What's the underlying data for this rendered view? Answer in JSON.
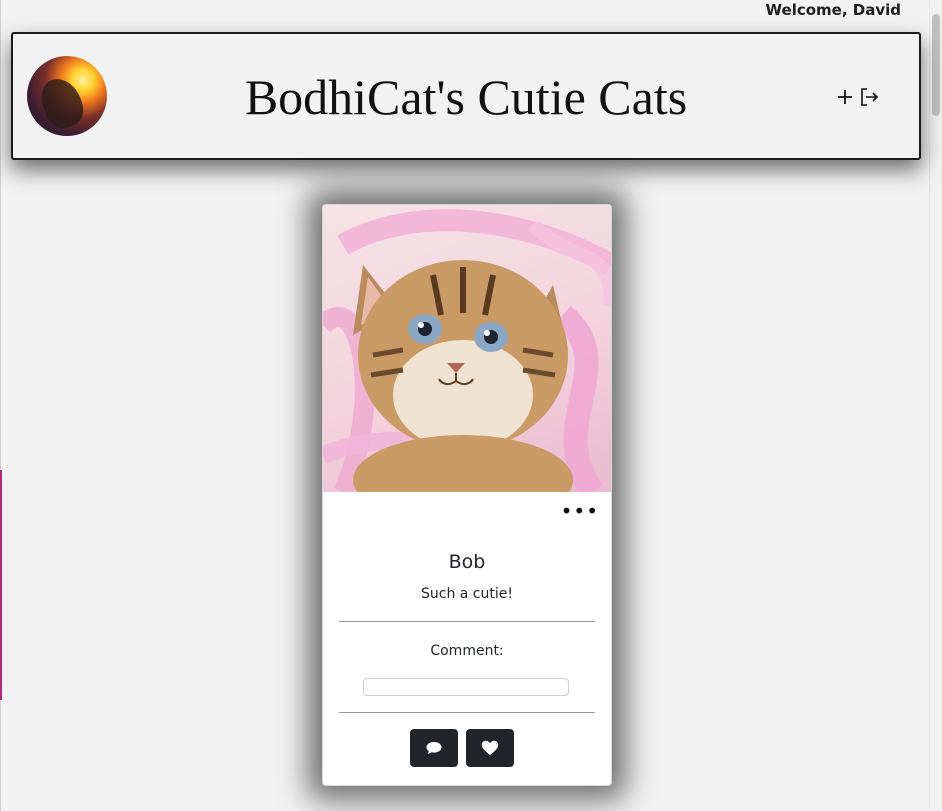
{
  "window": {
    "welcome_text": "Welcome, David"
  },
  "header": {
    "title": "BodhiCat's Cutie Cats",
    "avatar_icon": "cat-avatar-icon",
    "actions": [
      {
        "icon": "plus-icon",
        "label": "add"
      },
      {
        "icon": "logout-icon",
        "label": "sign out"
      }
    ]
  },
  "card": {
    "name": "Bob",
    "description": "Such a cutie!",
    "comment_label": "Comment:",
    "comment_placeholder": "",
    "comment_value": "",
    "more_icon": "ellipsis-icon",
    "photo_subject": "tabby kitten with pink ribbons",
    "buttons": [
      {
        "icon": "comment-icon"
      },
      {
        "icon": "heart-icon"
      }
    ]
  },
  "colors": {
    "background": "#f2f2f2",
    "header_border": "#1a1a1a",
    "button_dark": "#212529",
    "ribbon_pink": "#f0a7d1"
  }
}
